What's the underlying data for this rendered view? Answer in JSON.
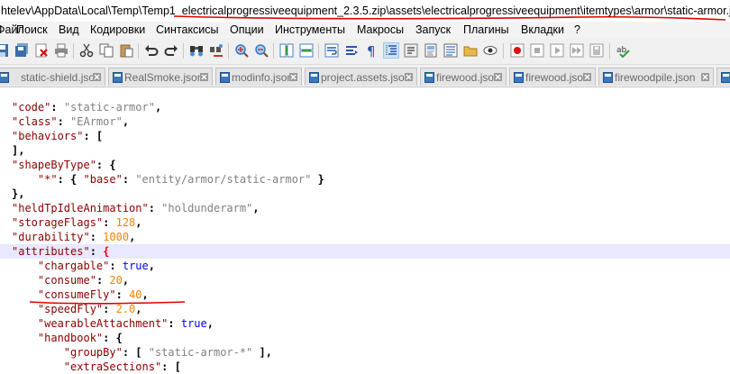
{
  "window": {
    "title": "htelev\\AppData\\Local\\Temp\\Temp1_electricalprogressiveequipment_2.3.5.zip\\assets\\electricalprogressiveequipment\\itemtypes\\armor\\static-armor.json - "
  },
  "menu": {
    "items": [
      "Файл",
      "Поиск",
      "Вид",
      "Кодировки",
      "Синтаксисы",
      "Опции",
      "Инструменты",
      "Макросы",
      "Запуск",
      "Плагины",
      "Вкладки",
      "?"
    ]
  },
  "toolbar": {
    "icons": [
      "new-file",
      "open-file",
      "save",
      "save-all",
      "close",
      "print",
      "cut",
      "copy",
      "paste",
      "undo",
      "redo",
      "find",
      "replace",
      "zoom-in",
      "zoom-out",
      "sync-scroll",
      "word-wrap",
      "show-all-chars",
      "indent-guide",
      "user-lang",
      "doc-map",
      "function-list",
      "folder-as-workspace",
      "monitoring",
      "record-macro",
      "stop-macro",
      "play-macro",
      "run-macro-multiple",
      "save-macro"
    ]
  },
  "tabs": [
    {
      "label": "static-shield.json"
    },
    {
      "label": "RealSmoke.json"
    },
    {
      "label": "modinfo.json"
    },
    {
      "label": "project.assets.json"
    },
    {
      "label": "firewood.json"
    },
    {
      "label": "firewood.json"
    },
    {
      "label": "firewoodpile.json"
    },
    {
      "label": "fire"
    }
  ],
  "editor": {
    "lines": [
      [
        [
          "k",
          "\"code\""
        ],
        [
          "p",
          ": "
        ],
        [
          "s",
          "\"static-armor\""
        ],
        [
          "p",
          ","
        ]
      ],
      [
        [
          "k",
          "\"class\""
        ],
        [
          "p",
          ": "
        ],
        [
          "s",
          "\"EArmor\""
        ],
        [
          "p",
          ","
        ]
      ],
      [
        [
          "k",
          "\"behaviors\""
        ],
        [
          "p",
          ": ["
        ]
      ],
      [
        [
          "p",
          "],"
        ]
      ],
      [
        [
          "k",
          "\"shapeByType\""
        ],
        [
          "p",
          ": {"
        ]
      ],
      [
        [
          "t",
          "    "
        ],
        [
          "k",
          "\"*\""
        ],
        [
          "p",
          ": { "
        ],
        [
          "k",
          "\"base\""
        ],
        [
          "p",
          ": "
        ],
        [
          "s",
          "\"entity/armor/static-armor\""
        ],
        [
          "p",
          " }"
        ]
      ],
      [
        [
          "p",
          "},"
        ]
      ],
      [
        [
          "k",
          "\"heldTpIdleAnimation\""
        ],
        [
          "p",
          ": "
        ],
        [
          "s",
          "\"holdunderarm\""
        ],
        [
          "p",
          ","
        ]
      ],
      [
        [
          "k",
          "\"storageFlags\""
        ],
        [
          "p",
          ": "
        ],
        [
          "n",
          "128"
        ],
        [
          "p",
          ","
        ]
      ],
      [
        [
          "k",
          "\"durability\""
        ],
        [
          "p",
          ": "
        ],
        [
          "n",
          "1000"
        ],
        [
          "p",
          ","
        ]
      ],
      [
        [
          "k",
          "\"attributes\""
        ],
        [
          "p",
          ": "
        ],
        [
          "brace",
          "{"
        ]
      ],
      [
        [
          "t",
          "    "
        ],
        [
          "k",
          "\"chargable\""
        ],
        [
          "p",
          ": "
        ],
        [
          "b",
          "true"
        ],
        [
          "p",
          ","
        ]
      ],
      [
        [
          "t",
          "    "
        ],
        [
          "k",
          "\"consume\""
        ],
        [
          "p",
          ": "
        ],
        [
          "n",
          "20"
        ],
        [
          "p",
          ","
        ]
      ],
      [
        [
          "t",
          "    "
        ],
        [
          "k",
          "\"consumeFly\""
        ],
        [
          "p",
          ": "
        ],
        [
          "n",
          "40"
        ],
        [
          "p",
          ","
        ]
      ],
      [
        [
          "t",
          "    "
        ],
        [
          "k",
          "\"speedFly\""
        ],
        [
          "p",
          ": "
        ],
        [
          "n",
          "2.0"
        ],
        [
          "p",
          ","
        ]
      ],
      [
        [
          "t",
          "    "
        ],
        [
          "k",
          "\"wearableAttachment\""
        ],
        [
          "p",
          ": "
        ],
        [
          "b",
          "true"
        ],
        [
          "p",
          ","
        ]
      ],
      [
        [
          "t",
          "    "
        ],
        [
          "k",
          "\"handbook\""
        ],
        [
          "p",
          ": {"
        ]
      ],
      [
        [
          "t",
          "        "
        ],
        [
          "k",
          "\"groupBy\""
        ],
        [
          "p",
          ": [ "
        ],
        [
          "s",
          "\"static-armor-*\""
        ],
        [
          "p",
          " ],"
        ]
      ],
      [
        [
          "t",
          "        "
        ],
        [
          "k",
          "\"extraSections\""
        ],
        [
          "p",
          ": ["
        ]
      ]
    ],
    "current_line_index": 10
  },
  "colors": {
    "key": "#8b0000",
    "string": "#808080",
    "number": "#ff8000",
    "boolean": "#0000ff",
    "annotation": "#e00000"
  }
}
